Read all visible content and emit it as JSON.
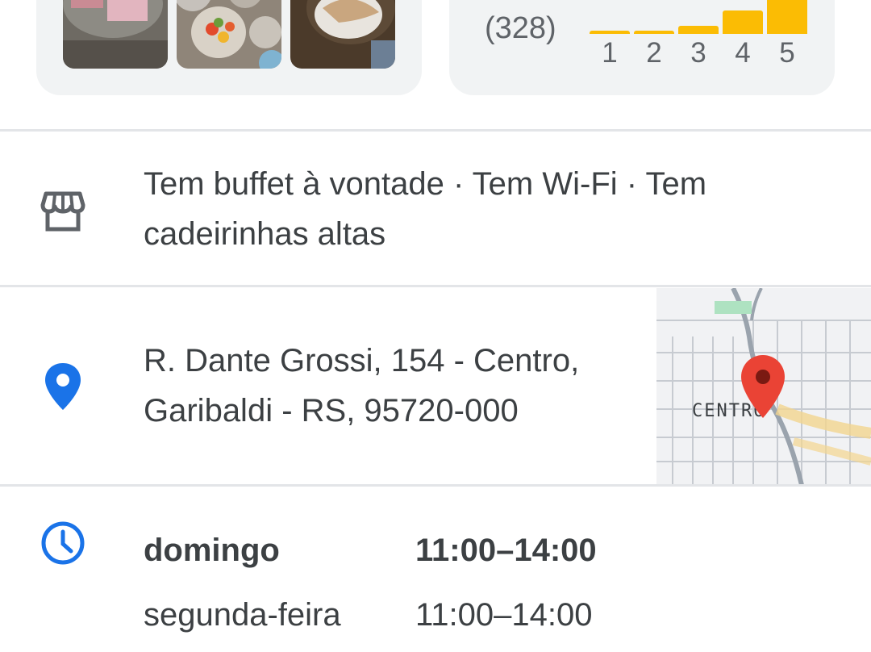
{
  "photos": {
    "items": [
      {
        "icon": "food-photo-1"
      },
      {
        "icon": "food-photo-2"
      },
      {
        "icon": "food-photo-3"
      }
    ]
  },
  "rating": {
    "review_count": "(328)",
    "distribution": [
      {
        "label": "1",
        "level": 0.05
      },
      {
        "label": "2",
        "level": 0.05
      },
      {
        "label": "3",
        "level": 0.14
      },
      {
        "label": "4",
        "level": 0.4
      },
      {
        "label": "5",
        "level": 1.0
      }
    ],
    "bar_color": "#fbbc04"
  },
  "amenities": {
    "icon": "store-icon",
    "text": "Tem buffet à vontade · Tem Wi-Fi · Tem cadeirinhas altas"
  },
  "address": {
    "icon": "location-pin-icon",
    "line1": "R. Dante Grossi, 154 - Centro,",
    "line2": "Garibaldi - RS, 95720-000",
    "map_label": "CENTRO",
    "pin_color": "#ea4335"
  },
  "hours": {
    "icon": "clock-icon",
    "rows": [
      {
        "day": "domingo",
        "time": "11:00–14:00"
      },
      {
        "day": "segunda-feira",
        "time": "11:00–14:00"
      }
    ]
  },
  "colors": {
    "accent_blue": "#1a73e8",
    "card_bg": "#f1f3f4"
  }
}
